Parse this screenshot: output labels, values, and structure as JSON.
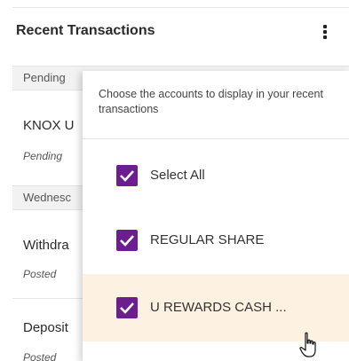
{
  "card": {
    "title": "Recent Transactions",
    "menu_icon": "kebab-vertical-icon"
  },
  "groups": [
    {
      "date_label": "Pending",
      "transactions": [
        {
          "name": "KNOX U",
          "status": "Pending"
        }
      ]
    },
    {
      "date_label": "Wednesc",
      "transactions": [
        {
          "name": "Withdra",
          "status": "Posted"
        },
        {
          "name": "Deposit",
          "status": "Posted"
        }
      ]
    }
  ],
  "account_filter": {
    "description": "Choose the accounts to display in your recent transactions",
    "options": [
      {
        "label": "Select All",
        "checked": true,
        "highlighted": false
      },
      {
        "label": "REGULAR SHARE",
        "checked": true,
        "highlighted": false
      },
      {
        "label": "U REWARDS CASH ...",
        "checked": true,
        "highlighted": true
      }
    ]
  },
  "colors": {
    "checkbox": "#6c1d8f",
    "highlight": "#fdf1e1",
    "section_bg": "#f2f2f2"
  },
  "cursor_icon": "hand-pointer-icon"
}
